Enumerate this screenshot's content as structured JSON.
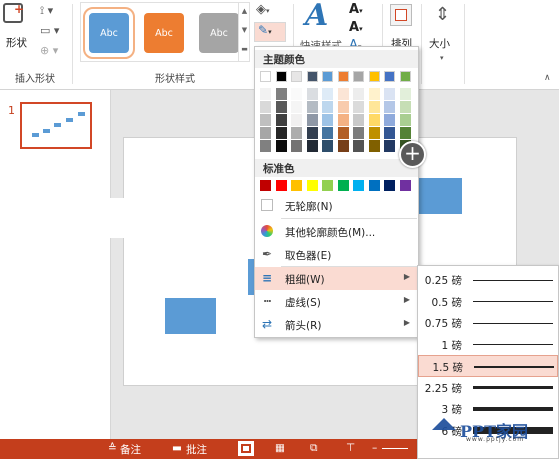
{
  "ribbon": {
    "shape_label": "形状",
    "insert_shape_group": "插入形状",
    "shape_styles_group": "形状样式",
    "quick_styles": "快速样式",
    "arrange": "排列",
    "size": "大小",
    "style_samples": [
      "Abc",
      "Abc",
      "Abc"
    ]
  },
  "thumbnail": {
    "number": "1"
  },
  "dropdown": {
    "theme_colors_header": "主题颜色",
    "standard_colors_header": "标准色",
    "no_outline": "无轮廓(N)",
    "more_colors": "其他轮廓颜色(M)...",
    "eyedropper": "取色器(E)",
    "weight": "粗细(W)",
    "dashes": "虚线(S)",
    "arrows": "箭头(R)",
    "theme_top": [
      "#ffffff",
      "#000000",
      "#e7e6e6",
      "#44546a",
      "#5b9bd5",
      "#ed7d31",
      "#a5a5a5",
      "#ffc000",
      "#4472c4",
      "#70ad47"
    ],
    "standard": [
      "#c00000",
      "#ff0000",
      "#ffc000",
      "#ffff00",
      "#92d050",
      "#00b050",
      "#00b0f0",
      "#0070c0",
      "#002060",
      "#7030a0"
    ]
  },
  "weights": [
    {
      "label": "0.25 磅",
      "w": 0.5
    },
    {
      "label": "0.5 磅",
      "w": 1
    },
    {
      "label": "0.75 磅",
      "w": 1
    },
    {
      "label": "1 磅",
      "w": 1.5
    },
    {
      "label": "1.5 磅",
      "w": 2
    },
    {
      "label": "2.25 磅",
      "w": 3
    },
    {
      "label": "3 磅",
      "w": 4
    },
    {
      "label": "6 磅",
      "w": 7
    }
  ],
  "statusbar": {
    "notes": "备注",
    "comments": "批注"
  },
  "watermark": {
    "text": "PPT家园",
    "sub": "www.pptjy.com"
  }
}
